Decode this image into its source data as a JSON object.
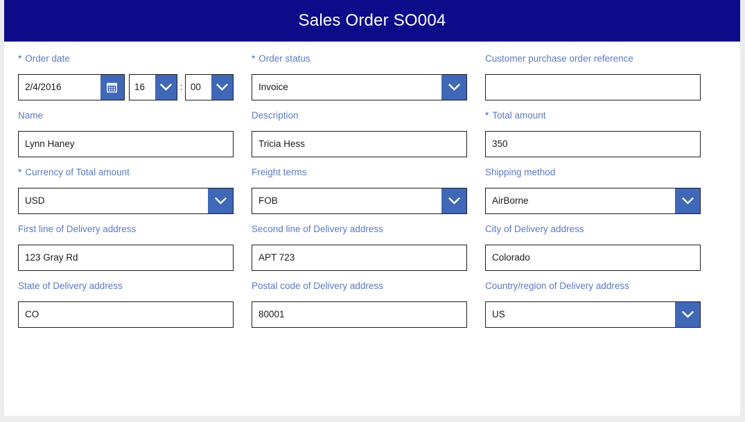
{
  "header": {
    "title": "Sales Order SO004",
    "bar_color": "#0c0c8a",
    "title_color": "#ffffff"
  },
  "theme": {
    "label_color": "#5b78c4",
    "accent_blue": "#4068b8",
    "input_border": "#1c1c1c",
    "page_background": "#ececed",
    "card_background": "#ffffff"
  },
  "icons": {
    "calendar": "calendar-icon",
    "chevron_down": "chevron-down-icon"
  },
  "form": {
    "required_marker": "*",
    "time_separator": ":",
    "rows": [
      {
        "fields": [
          {
            "name": "order-date",
            "label": "Order date",
            "required": true,
            "type": "datetime",
            "date_value": "2/4/2016",
            "hour_value": "16",
            "minute_value": "00",
            "placeholder": ""
          },
          {
            "name": "order-status",
            "label": "Order status",
            "required": true,
            "type": "select",
            "value": "Invoice",
            "placeholder": ""
          },
          {
            "name": "customer-purchase-order-reference",
            "label": "Customer purchase order reference",
            "required": false,
            "type": "text",
            "value": "",
            "placeholder": ""
          }
        ]
      },
      {
        "fields": [
          {
            "name": "name",
            "label": "Name",
            "required": false,
            "type": "text",
            "value": "Lynn Haney",
            "placeholder": ""
          },
          {
            "name": "description",
            "label": "Description",
            "required": false,
            "type": "text",
            "value": "Tricia Hess",
            "placeholder": ""
          },
          {
            "name": "total-amount",
            "label": "Total amount",
            "required": true,
            "type": "text",
            "value": "350",
            "placeholder": ""
          }
        ]
      },
      {
        "fields": [
          {
            "name": "currency-of-total-amount",
            "label": "Currency of Total amount",
            "required": true,
            "type": "select",
            "value": "USD",
            "placeholder": ""
          },
          {
            "name": "freight-terms",
            "label": "Freight terms",
            "required": false,
            "type": "select",
            "value": "FOB",
            "placeholder": ""
          },
          {
            "name": "shipping-method",
            "label": "Shipping method",
            "required": false,
            "type": "select",
            "value": "AirBorne",
            "placeholder": ""
          }
        ]
      },
      {
        "fields": [
          {
            "name": "first-line-of-delivery-address",
            "label": "First line of Delivery address",
            "required": false,
            "type": "text",
            "value": "123 Gray Rd",
            "placeholder": ""
          },
          {
            "name": "second-line-of-delivery-address",
            "label": "Second line of Delivery address",
            "required": false,
            "type": "text",
            "value": "APT 723",
            "placeholder": ""
          },
          {
            "name": "city-of-delivery-address",
            "label": "City of Delivery address",
            "required": false,
            "type": "text",
            "value": "Colorado",
            "placeholder": ""
          }
        ]
      },
      {
        "fields": [
          {
            "name": "state-of-delivery-address",
            "label": "State of Delivery address",
            "required": false,
            "type": "text",
            "value": "CO",
            "placeholder": ""
          },
          {
            "name": "postal-code-of-delivery-address",
            "label": "Postal code of Delivery address",
            "required": false,
            "type": "text",
            "value": "80001",
            "placeholder": ""
          },
          {
            "name": "country-region-of-delivery-address",
            "label": "Country/region of Delivery address",
            "required": false,
            "type": "select",
            "value": "US",
            "placeholder": ""
          }
        ]
      }
    ]
  }
}
